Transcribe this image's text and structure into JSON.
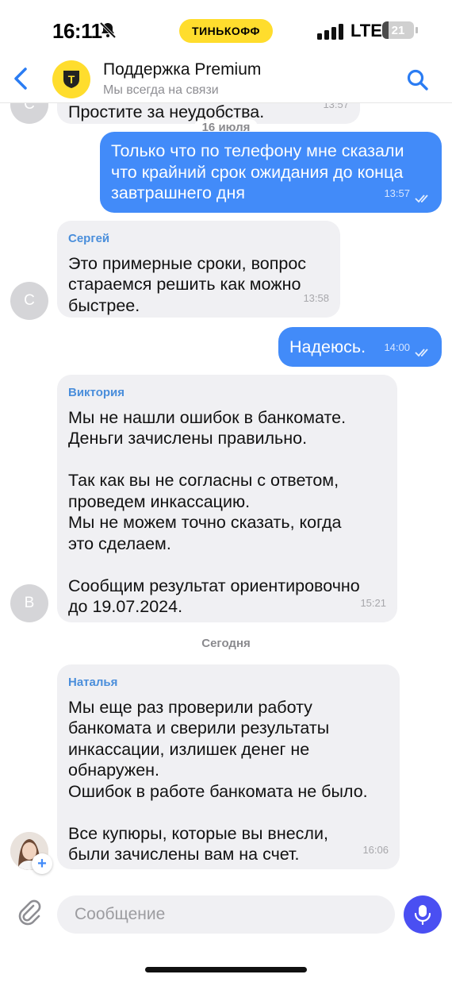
{
  "status_bar": {
    "time": "16:11",
    "carrier_badge": "ТИНЬКОФФ",
    "network": "LTE",
    "battery_level": "21",
    "battery_fraction": 0.21,
    "icons": [
      "bell-slash-icon",
      "signal-bars-icon",
      "battery-icon"
    ]
  },
  "header": {
    "title": "Поддержка Premium",
    "subtitle": "Мы всегда на связи",
    "logo_letter": "Т",
    "icons": [
      "back-chevron-icon",
      "search-icon"
    ]
  },
  "messages": {
    "partial_top": {
      "text": "Простите за неудобства.",
      "time": "13:57",
      "avatar_letter": "С"
    },
    "date_1": "16 июля",
    "m1": {
      "text": "Только что по телефону мне сказали\nчто крайний срок ожидания до конца\nзавтрашнего дня",
      "time": "13:57"
    },
    "m2": {
      "sender": "Сергей",
      "text": "Это примерные сроки, вопрос\nстараемся решить как можно\nбыстрее.",
      "time": "13:58",
      "avatar_letter": "С"
    },
    "m3": {
      "text": "Надеюсь.",
      "time": "14:00"
    },
    "m4": {
      "sender": "Виктория",
      "text": "Мы не нашли ошибок в банкомате.\nДеньги зачислены правильно.\n\nТак как вы не согласны с ответом,\nпроведем инкассацию.\nМы не можем точно сказать, когда\nэто сделаем.\n\nСообщим результат ориентировочно\nдо 19.07.2024.",
      "time": "15:21",
      "avatar_letter": "В"
    },
    "date_2": "Сегодня",
    "m5": {
      "sender": "Наталья",
      "text": "Мы еще раз проверили работу\nбанкомата и сверили результаты\nинкассации, излишек денег не\nобнаружен.\nОшибок в работе банкомата не было.\n\nВсе купюры, которые вы внесли,\nбыли зачислены вам на счет.",
      "time": "16:06",
      "badge": "+"
    }
  },
  "composer": {
    "placeholder": "Сообщение",
    "value": "",
    "icons": [
      "paperclip-icon",
      "microphone-icon"
    ]
  },
  "colors": {
    "brand_yellow": "#ffdd2d",
    "outgoing_bubble": "#428bf9",
    "incoming_bubble": "#f0f0f3",
    "sender_name": "#4a8edb",
    "mic_button": "#4a4ff2"
  }
}
